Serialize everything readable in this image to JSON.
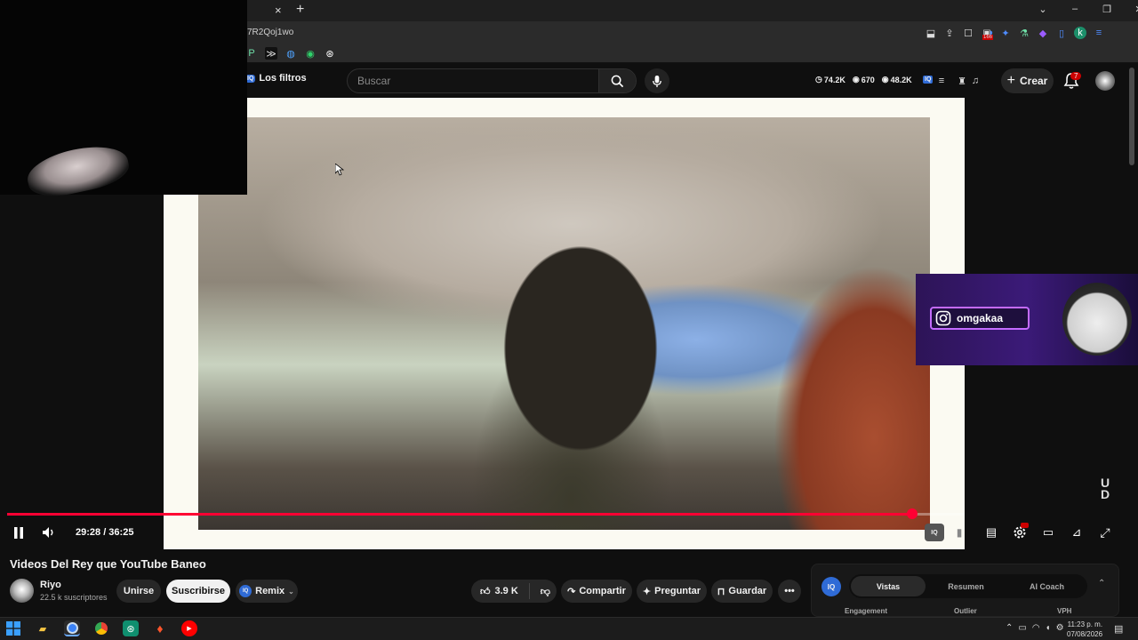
{
  "browser": {
    "tab_close": "×",
    "new_tab": "+",
    "url_fragment": "7R2Qoj1wo",
    "window_controls": [
      "⌄",
      "–",
      "❐",
      "✕"
    ],
    "ext_badge": "166",
    "profile_initial": "k"
  },
  "youtube_header": {
    "filter_label": "Los filtros",
    "search_placeholder": "Buscar",
    "stats": [
      {
        "icon": "clock-icon",
        "value": "74.2K"
      },
      {
        "icon": "eye-icon",
        "value": "670"
      },
      {
        "icon": "eye-icon",
        "value": "48.2K"
      }
    ],
    "create_label": "Crear",
    "notifications_count": "7"
  },
  "overlay": {
    "instagram_handle": "omgakaa"
  },
  "player": {
    "time": "29:28 / 36:25",
    "progress_fraction": 0.945
  },
  "video": {
    "title": "Videos Del Rey que YouTube Baneo",
    "channel_name": "Riyo",
    "subscribers": "22.5 k suscriptores",
    "join_label": "Unirse",
    "subscribe_label": "Suscribirse",
    "remix_label": "Remix",
    "likes": "3.9 K",
    "share_label": "Compartir",
    "ask_label": "Preguntar",
    "save_label": "Guardar"
  },
  "iq_panel": {
    "tabs": [
      "Vistas",
      "Resumen",
      "AI Coach"
    ],
    "columns": [
      "Engagement",
      "Outlier",
      "VPH"
    ]
  },
  "taskbar": {
    "time": "11:23 p. m.",
    "date": "07/08/2026"
  },
  "colors": {
    "accent_red": "#ff0033",
    "youtube_dark": "#0f0f0f",
    "ig_purple": "#3b1a78"
  }
}
